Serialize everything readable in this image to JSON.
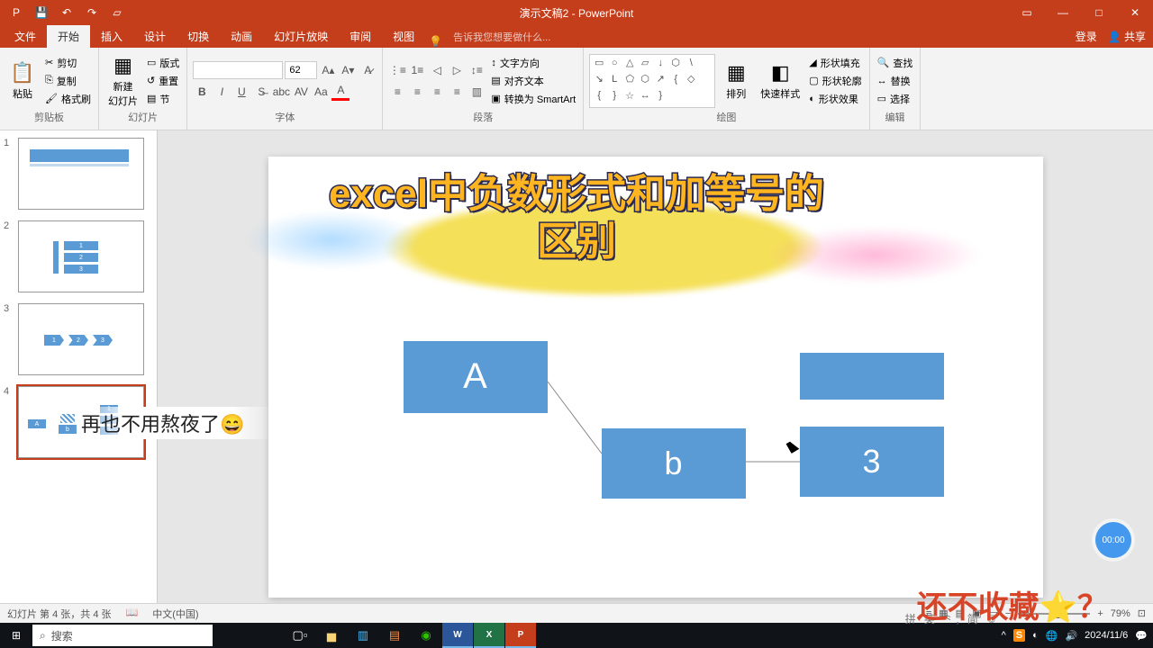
{
  "titlebar": {
    "title": "演示文稿2 - PowerPoint"
  },
  "tabs": {
    "file": "文件",
    "home": "开始",
    "insert": "插入",
    "design": "设计",
    "transitions": "切换",
    "animations": "动画",
    "slideshow": "幻灯片放映",
    "review": "审阅",
    "view": "视图",
    "tellme": "告诉我您想要做什么...",
    "login": "登录",
    "share": "共享"
  },
  "ribbon": {
    "clipboard": {
      "label": "剪贴板",
      "paste": "粘贴",
      "cut": "剪切",
      "copy": "复制",
      "painter": "格式刷"
    },
    "slides": {
      "label": "幻灯片",
      "new": "新建\n幻灯片",
      "layout": "版式",
      "reset": "重置",
      "section": "节"
    },
    "font": {
      "label": "字体",
      "size": "62"
    },
    "paragraph": {
      "label": "段落",
      "direction": "文字方向",
      "align": "对齐文本",
      "smartart": "转换为 SmartArt"
    },
    "drawing": {
      "label": "绘图",
      "arrange": "排列",
      "quickstyle": "快速样式",
      "fill": "形状填充",
      "outline": "形状轮廓",
      "effects": "形状效果"
    },
    "editing": {
      "label": "编辑",
      "find": "查找",
      "replace": "替换",
      "select": "选择"
    }
  },
  "thumbs": {
    "n1": "1",
    "n2": "2",
    "n3": "3",
    "n4": "4"
  },
  "slide": {
    "blockA": "A",
    "blockB": "b",
    "block3": "3"
  },
  "overlay": {
    "title1": "excel中负数形式和加等号的",
    "title2": "区别",
    "callout": "再也不用熬夜了😄",
    "timer": "00:00",
    "collect": "还不收藏⭐？"
  },
  "status": {
    "slideinfo": "幻灯片 第 4 张，共 4 张",
    "lang": "中文(中国)",
    "zoom": "79%",
    "ime": "拼 英 ⺀, 简 ☺"
  },
  "taskbar": {
    "search": "搜索",
    "date": "2024/11/6"
  }
}
